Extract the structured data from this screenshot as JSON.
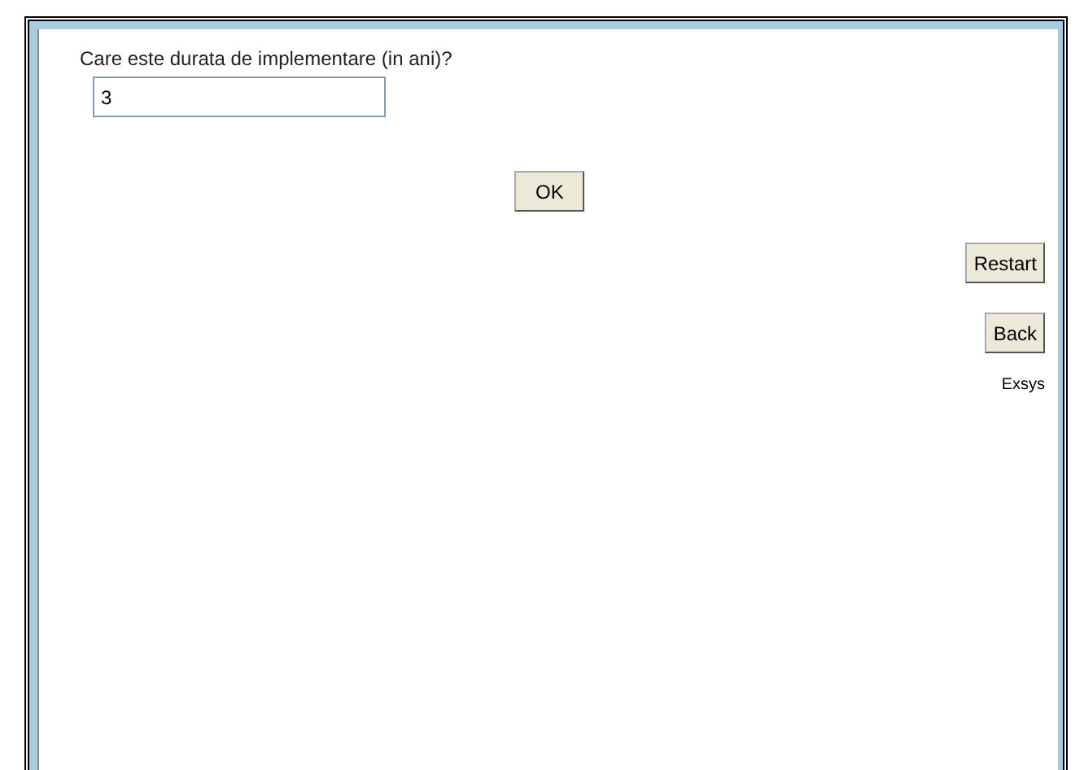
{
  "question": {
    "label": "Care este durata de implementare (in ani)?",
    "value": "3"
  },
  "ok_button": "OK",
  "side_buttons": [
    "Restart",
    "Back"
  ],
  "footer_text": "Exsys"
}
